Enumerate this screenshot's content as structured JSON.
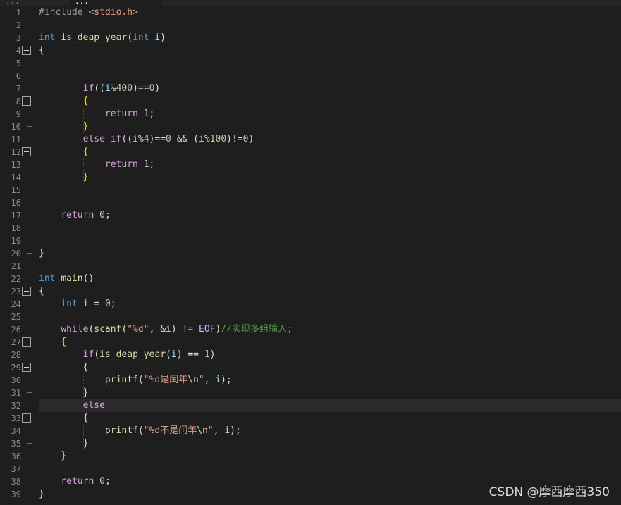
{
  "tabs": [
    {
      "label": "..."
    },
    {
      "label": "..."
    }
  ],
  "lines": [
    {
      "n": "1",
      "segs": [
        {
          "t": "#include ",
          "c": "pp"
        },
        {
          "t": "<stdio.h>",
          "c": "inc"
        }
      ]
    },
    {
      "n": "2",
      "segs": []
    },
    {
      "n": "3",
      "segs": [
        {
          "t": "int",
          "c": "kw"
        },
        {
          "t": " "
        },
        {
          "t": "is_deap_year",
          "c": "fn"
        },
        {
          "t": "("
        },
        {
          "t": "int",
          "c": "kw"
        },
        {
          "t": " "
        },
        {
          "t": "i",
          "c": "var"
        },
        {
          "t": ")"
        }
      ]
    },
    {
      "n": "4",
      "fold": "box",
      "segs": [
        {
          "t": "{"
        }
      ]
    },
    {
      "n": "5",
      "fold": "line",
      "segs": []
    },
    {
      "n": "6",
      "fold": "line",
      "segs": []
    },
    {
      "n": "7",
      "fold": "line",
      "segs": [
        {
          "t": "        "
        },
        {
          "t": "if",
          "c": "ctl"
        },
        {
          "t": "(("
        },
        {
          "t": "i",
          "c": "var"
        },
        {
          "t": "%"
        },
        {
          "t": "400",
          "c": "num"
        },
        {
          "t": ")=="
        },
        {
          "t": "0",
          "c": "num"
        },
        {
          "t": ")"
        }
      ]
    },
    {
      "n": "8",
      "fold": "box",
      "segs": [
        {
          "t": "        "
        },
        {
          "t": "{",
          "c": "br1"
        }
      ]
    },
    {
      "n": "9",
      "fold": "line",
      "segs": [
        {
          "t": "            "
        },
        {
          "t": "return",
          "c": "ctl"
        },
        {
          "t": " "
        },
        {
          "t": "1",
          "c": "num"
        },
        {
          "t": ";"
        }
      ]
    },
    {
      "n": "10",
      "fold": "end",
      "segs": [
        {
          "t": "        "
        },
        {
          "t": "}",
          "c": "br1"
        }
      ]
    },
    {
      "n": "11",
      "fold": "line",
      "segs": [
        {
          "t": "        "
        },
        {
          "t": "else",
          "c": "ctl"
        },
        {
          "t": " "
        },
        {
          "t": "if",
          "c": "ctl"
        },
        {
          "t": "(("
        },
        {
          "t": "i",
          "c": "var"
        },
        {
          "t": "%"
        },
        {
          "t": "4",
          "c": "num"
        },
        {
          "t": ")=="
        },
        {
          "t": "0",
          "c": "num"
        },
        {
          "t": " && ("
        },
        {
          "t": "i",
          "c": "var"
        },
        {
          "t": "%"
        },
        {
          "t": "100",
          "c": "num"
        },
        {
          "t": ")!="
        },
        {
          "t": "0",
          "c": "num"
        },
        {
          "t": ")"
        }
      ]
    },
    {
      "n": "12",
      "fold": "box",
      "segs": [
        {
          "t": "        "
        },
        {
          "t": "{",
          "c": "br1"
        }
      ]
    },
    {
      "n": "13",
      "fold": "line",
      "segs": [
        {
          "t": "            "
        },
        {
          "t": "return",
          "c": "ctl"
        },
        {
          "t": " "
        },
        {
          "t": "1",
          "c": "num"
        },
        {
          "t": ";"
        }
      ]
    },
    {
      "n": "14",
      "fold": "end",
      "segs": [
        {
          "t": "        "
        },
        {
          "t": "}",
          "c": "br1"
        }
      ]
    },
    {
      "n": "15",
      "fold": "line",
      "segs": []
    },
    {
      "n": "16",
      "fold": "line",
      "segs": []
    },
    {
      "n": "17",
      "fold": "line",
      "segs": [
        {
          "t": "    "
        },
        {
          "t": "return",
          "c": "ctl"
        },
        {
          "t": " "
        },
        {
          "t": "0",
          "c": "num"
        },
        {
          "t": ";"
        }
      ]
    },
    {
      "n": "18",
      "fold": "line",
      "segs": []
    },
    {
      "n": "19",
      "fold": "line",
      "segs": []
    },
    {
      "n": "20",
      "fold": "end",
      "segs": [
        {
          "t": "}"
        }
      ]
    },
    {
      "n": "21",
      "segs": []
    },
    {
      "n": "22",
      "segs": [
        {
          "t": "int",
          "c": "kw"
        },
        {
          "t": " "
        },
        {
          "t": "main",
          "c": "fn"
        },
        {
          "t": "()"
        }
      ]
    },
    {
      "n": "23",
      "fold": "box",
      "segs": [
        {
          "t": "{"
        }
      ]
    },
    {
      "n": "24",
      "fold": "line",
      "segs": [
        {
          "t": "    "
        },
        {
          "t": "int",
          "c": "kw"
        },
        {
          "t": " "
        },
        {
          "t": "i",
          "c": "var"
        },
        {
          "t": " = "
        },
        {
          "t": "0",
          "c": "num"
        },
        {
          "t": ";"
        }
      ]
    },
    {
      "n": "25",
      "fold": "line",
      "segs": []
    },
    {
      "n": "26",
      "fold": "line",
      "segs": [
        {
          "t": "    "
        },
        {
          "t": "while",
          "c": "ctl"
        },
        {
          "t": "("
        },
        {
          "t": "scanf",
          "c": "fn"
        },
        {
          "t": "("
        },
        {
          "t": "\"%d\"",
          "c": "str"
        },
        {
          "t": ", &"
        },
        {
          "t": "i",
          "c": "var"
        },
        {
          "t": ") != "
        },
        {
          "t": "EOF",
          "c": "mac"
        },
        {
          "t": ")"
        },
        {
          "t": "//实现多组输入;",
          "c": "cmt"
        }
      ]
    },
    {
      "n": "27",
      "fold": "box",
      "segs": [
        {
          "t": "    "
        },
        {
          "t": "{",
          "c": "br1"
        }
      ]
    },
    {
      "n": "28",
      "fold": "line",
      "segs": [
        {
          "t": "        "
        },
        {
          "t": "if",
          "c": "ctl"
        },
        {
          "t": "("
        },
        {
          "t": "is_deap_year",
          "c": "fn"
        },
        {
          "t": "("
        },
        {
          "t": "i",
          "c": "var"
        },
        {
          "t": ") == "
        },
        {
          "t": "1",
          "c": "num"
        },
        {
          "t": ")"
        }
      ]
    },
    {
      "n": "29",
      "fold": "box",
      "segs": [
        {
          "t": "        "
        },
        {
          "t": "{"
        }
      ]
    },
    {
      "n": "30",
      "fold": "line",
      "segs": [
        {
          "t": "            "
        },
        {
          "t": "printf",
          "c": "fn"
        },
        {
          "t": "("
        },
        {
          "t": "\"%d是闰年",
          "c": "str"
        },
        {
          "t": "\\n",
          "c": "esc"
        },
        {
          "t": "\"",
          "c": "str"
        },
        {
          "t": ", "
        },
        {
          "t": "i",
          "c": "var"
        },
        {
          "t": ");"
        }
      ]
    },
    {
      "n": "31",
      "fold": "end",
      "segs": [
        {
          "t": "        "
        },
        {
          "t": "}"
        }
      ]
    },
    {
      "n": "32",
      "fold": "line",
      "current": true,
      "segs": [
        {
          "t": "        "
        },
        {
          "t": "else",
          "c": "ctl"
        }
      ]
    },
    {
      "n": "33",
      "fold": "box",
      "segs": [
        {
          "t": "        "
        },
        {
          "t": "{"
        }
      ]
    },
    {
      "n": "34",
      "fold": "line",
      "segs": [
        {
          "t": "            "
        },
        {
          "t": "printf",
          "c": "fn"
        },
        {
          "t": "("
        },
        {
          "t": "\"%d不是闰年",
          "c": "str"
        },
        {
          "t": "\\n",
          "c": "esc"
        },
        {
          "t": "\"",
          "c": "str"
        },
        {
          "t": ", "
        },
        {
          "t": "i",
          "c": "var"
        },
        {
          "t": ");"
        }
      ]
    },
    {
      "n": "35",
      "fold": "end",
      "segs": [
        {
          "t": "        "
        },
        {
          "t": "}"
        }
      ]
    },
    {
      "n": "36",
      "fold": "end",
      "segs": [
        {
          "t": "    "
        },
        {
          "t": "}",
          "c": "br1"
        }
      ]
    },
    {
      "n": "37",
      "fold": "line",
      "segs": []
    },
    {
      "n": "38",
      "fold": "line",
      "segs": [
        {
          "t": "    "
        },
        {
          "t": "return",
          "c": "ctl"
        },
        {
          "t": " "
        },
        {
          "t": "0",
          "c": "num"
        },
        {
          "t": ";"
        }
      ]
    },
    {
      "n": "39",
      "fold": "end",
      "segs": [
        {
          "t": "}"
        }
      ]
    }
  ],
  "watermark": "CSDN @摩西摩西350",
  "icons": {
    "fold_box": "collapse-box-icon"
  }
}
